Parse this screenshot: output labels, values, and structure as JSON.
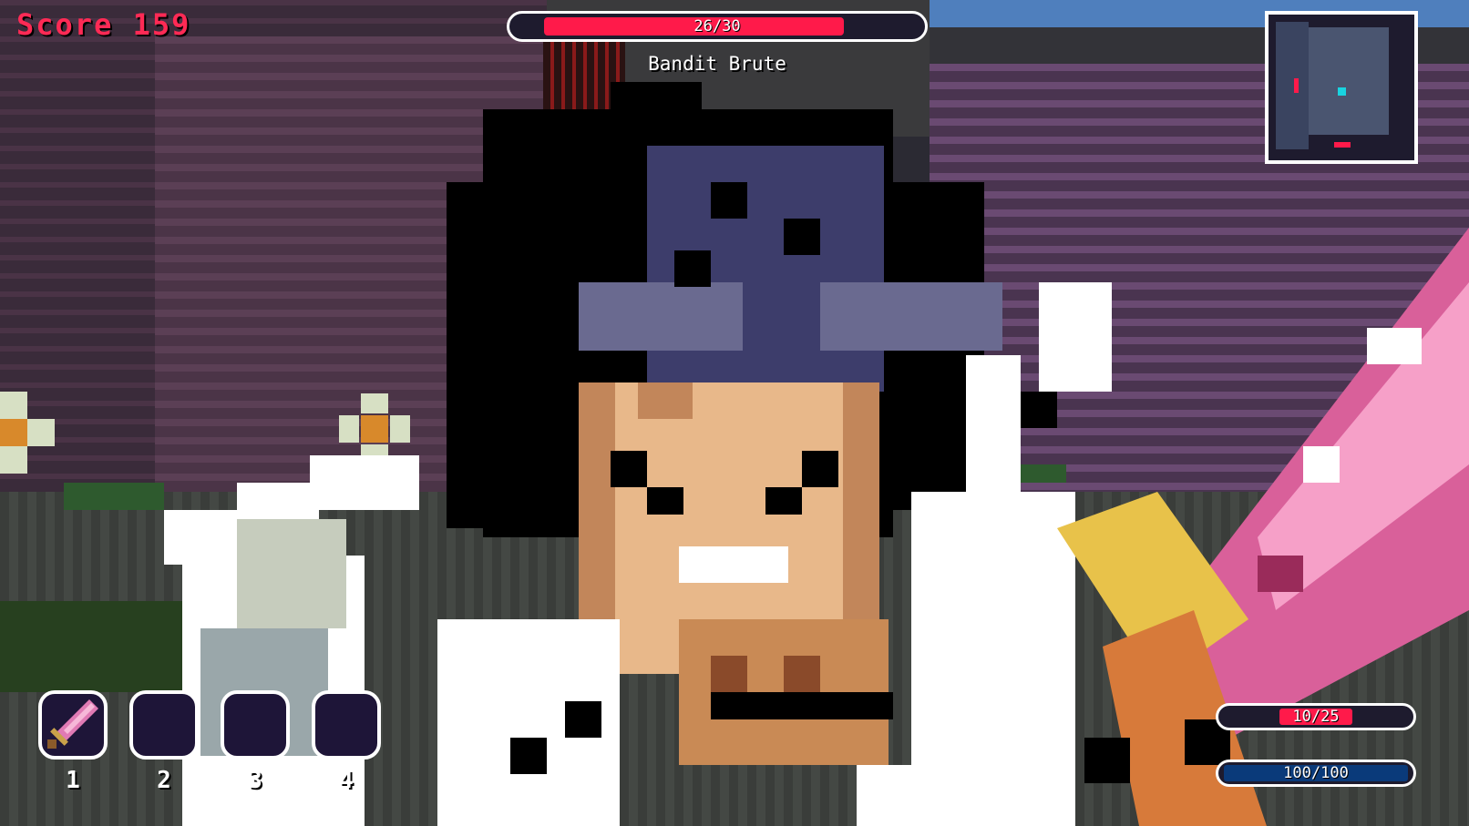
{
  "hud": {
    "score_label": "Score 159",
    "boss": {
      "hp_text": "26/30",
      "hp_current": 26,
      "hp_max": 30,
      "name": "Bandit Brute"
    },
    "hotbar": {
      "slots": [
        {
          "number": "1",
          "item_icon": "pink-sword-icon"
        },
        {
          "number": "2",
          "item_icon": "empty"
        },
        {
          "number": "3",
          "item_icon": "empty"
        },
        {
          "number": "4",
          "item_icon": "empty"
        }
      ]
    },
    "health": {
      "text": "10/25",
      "current": 10,
      "max": 25,
      "color": "#ff1a4a"
    },
    "mana": {
      "text": "100/100",
      "current": 100,
      "max": 100,
      "color": "#0a3a7a"
    }
  },
  "colors": {
    "accent_red": "#ff2a55",
    "hud_dark": "#1e1b2e",
    "minimap_player": "#19d3e0"
  }
}
